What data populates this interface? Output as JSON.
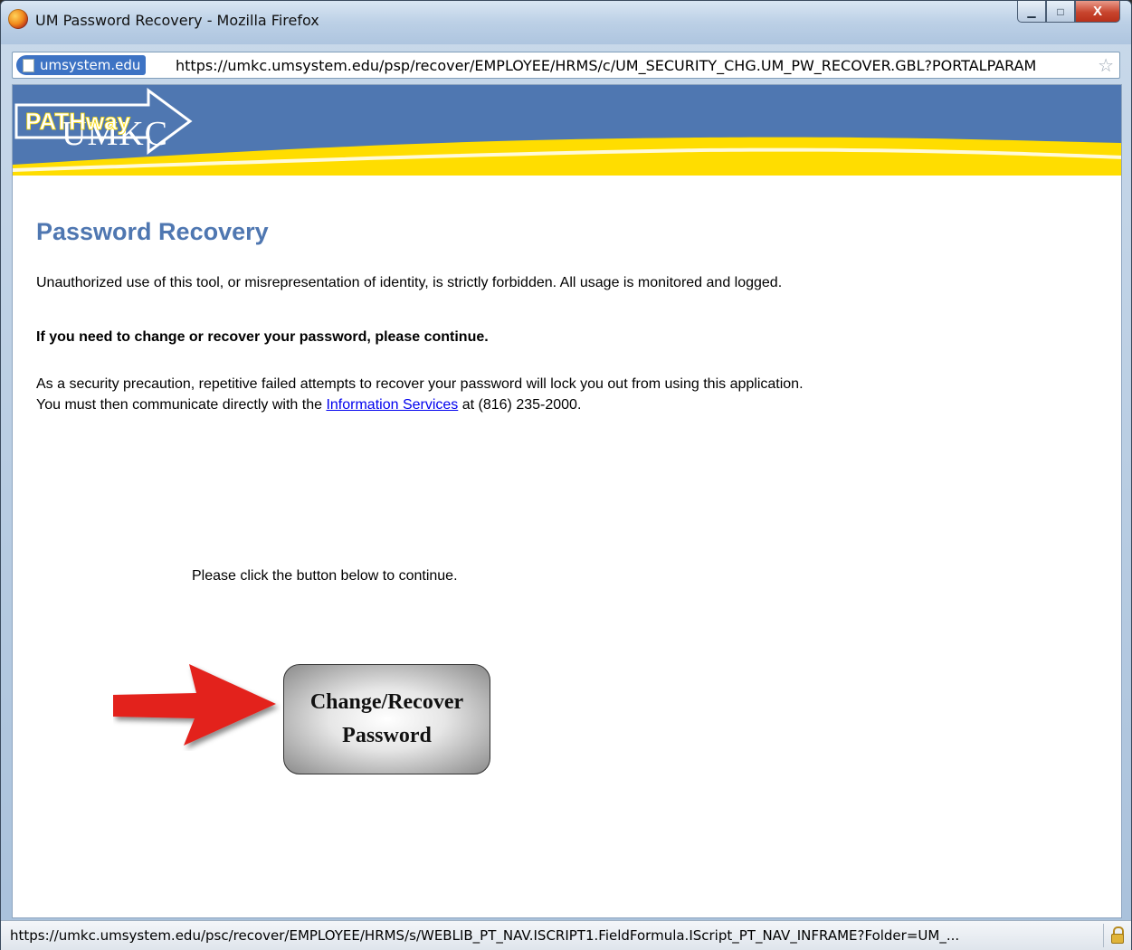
{
  "window": {
    "title": "UM Password Recovery - Mozilla Firefox",
    "controls": {
      "minimize": "▁",
      "maximize": "□",
      "close": "X"
    }
  },
  "address_bar": {
    "site_identity": "umsystem.edu",
    "url": "https://umkc.umsystem.edu/psp/recover/EMPLOYEE/HRMS/c/UM_SECURITY_CHG.UM_PW_RECOVER.GBL?PORTALPARAM",
    "bookmark_star": "☆"
  },
  "banner": {
    "left_logo": "UMKC",
    "right_logo": "PATHway",
    "colors": {
      "blue": "#4f77b1",
      "gold": "#ffdd00"
    }
  },
  "page": {
    "title": "Password Recovery",
    "warning": "Unauthorized use of this tool, or misrepresentation of identity, is strictly forbidden. All usage is monitored and logged.",
    "instruction": "If you need to change or recover your password, please continue.",
    "security_line1": "As a security precaution, repetitive failed attempts to recover your password will lock you out from using this application.",
    "security_line2_prefix": "You must then communicate directly with the ",
    "security_link": "Information Services",
    "security_line2_suffix": " at (816) 235-2000.",
    "click_prompt": "Please click the button below to continue.",
    "button_line1": "Change/Recover",
    "button_line2": "Password",
    "arrow_color": "#e3201b"
  },
  "status_bar": {
    "text": "https://umkc.umsystem.edu/psc/recover/EMPLOYEE/HRMS/s/WEBLIB_PT_NAV.ISCRIPT1.FieldFormula.IScript_PT_NAV_INFRAME?Folder=UM_...",
    "security_icon": "lock-icon"
  }
}
